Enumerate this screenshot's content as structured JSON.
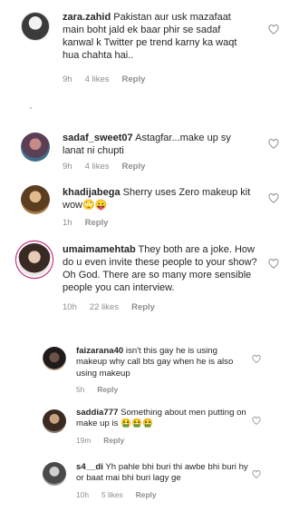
{
  "comments": [
    {
      "username": "zara.zahid",
      "text": " Pakistan aur usk mazafaat main boht jald ek baar phir se sadaf kanwal k Twitter pe trend karny ka waqt hua chahta hai..",
      "time": "9h",
      "likes": "4 likes",
      "reply": "Reply"
    },
    {
      "username": "sadaf_sweet07",
      "text": " Astagfar...make up sy lanat ni chupti",
      "time": "9h",
      "likes": "4 likes",
      "reply": "Reply"
    },
    {
      "username": "khadijabega",
      "text": " Sherry uses Zero makeup kit wow🙄😛",
      "time": "1h",
      "likes": "",
      "reply": "Reply"
    },
    {
      "username": "umaimamehtab",
      "text": " They both are a joke. How do u even invite these people to your show? Oh God. There are so many more sensible people you can interview.",
      "time": "10h",
      "likes": "22 likes",
      "reply": "Reply"
    }
  ],
  "replies": [
    {
      "username": "faizarana40",
      "text": " isn't this gay he is using makeup why call bts gay when he is also using makeup",
      "time": "5h",
      "likes": "",
      "reply": "Reply"
    },
    {
      "username": "saddia777",
      "text": " Something about men putting on make up is 🤮🤮🤮",
      "time": "19m",
      "likes": "",
      "reply": "Reply"
    },
    {
      "username": "s4__di",
      "text": " Yh pahle bhi buri thi awbe bhi buri hy or baat mai bhi buri lagy ge",
      "time": "10h",
      "likes": "5 likes",
      "reply": "Reply"
    }
  ],
  "icons": {
    "like": "heart-outline-icon"
  },
  "colors": {
    "meta_text": "#8e8e8e",
    "story_ring": "#c13584"
  }
}
